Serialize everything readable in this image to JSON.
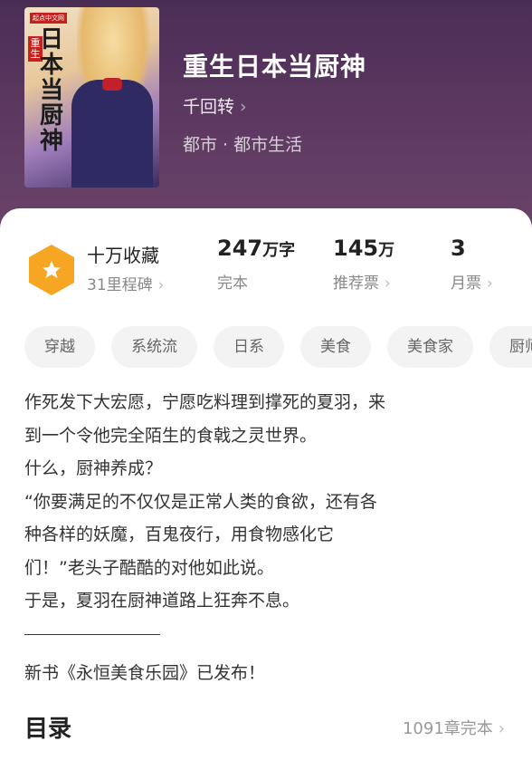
{
  "book": {
    "title": "重生日本当厨神",
    "author": "千回转",
    "genre": "都市 · 都市生活",
    "cover": {
      "badge": "起点中文网",
      "vertical_title": "日本当厨神",
      "vertical_small": "重生"
    }
  },
  "stats": {
    "favorites": {
      "title": "十万收藏",
      "subtitle": "31里程碑"
    },
    "words": {
      "value": "247",
      "unit": "万字",
      "label": "完本"
    },
    "recommend": {
      "value": "145",
      "unit": "万",
      "label": "推荐票"
    },
    "monthly": {
      "value": "3",
      "unit": "",
      "label": "月票"
    }
  },
  "tags": [
    "穿越",
    "系统流",
    "日系",
    "美食",
    "美食家",
    "厨师"
  ],
  "description": [
    "作死发下大宏愿，宁愿吃料理到撑死的夏羽，来",
    "到一个令他完全陌生的食戟之灵世界。",
    "什么，厨神养成？",
    "“你要满足的不仅仅是正常人类的食欲，还有各",
    "种各样的妖魔，百鬼夜行，用食物感化它",
    "们！”老头子酷酷的对他如此说。",
    "于是，夏羽在厨神道路上狂奔不息。"
  ],
  "new_book": "新书《永恒美食乐园》已发布！",
  "toc": {
    "title": "目录",
    "count": "1091章完本"
  },
  "colors": {
    "header_bg": "#5e3a62",
    "medal": "#f6a623"
  }
}
